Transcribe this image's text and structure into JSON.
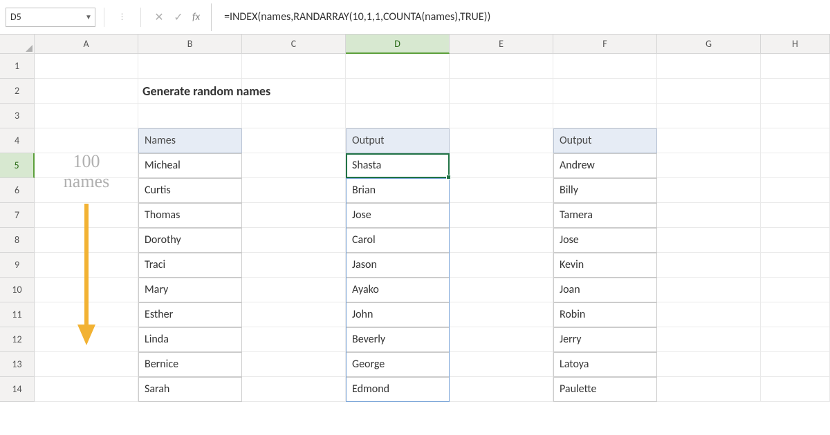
{
  "name_box": "D5",
  "formula": "=INDEX(names,RANDARRAY(10,1,1,COUNTA(names),TRUE))",
  "columns": [
    "A",
    "B",
    "C",
    "D",
    "E",
    "F",
    "G",
    "H"
  ],
  "rows": [
    "1",
    "2",
    "3",
    "4",
    "5",
    "6",
    "7",
    "8",
    "9",
    "10",
    "11",
    "12",
    "13",
    "14"
  ],
  "title": "Generate random names",
  "annotation": {
    "line1": "100",
    "line2": "names"
  },
  "tables": {
    "names": {
      "header": "Names",
      "rows": [
        "Micheal",
        "Curtis",
        "Thomas",
        "Dorothy",
        "Traci",
        "Mary",
        "Esther",
        "Linda",
        "Bernice",
        "Sarah"
      ]
    },
    "out1": {
      "header": "Output",
      "rows": [
        "Shasta",
        "Brian",
        "Jose",
        "Carol",
        "Jason",
        "Ayako",
        "John",
        "Beverly",
        "George",
        "Edmond"
      ]
    },
    "out2": {
      "header": "Output",
      "rows": [
        "Andrew",
        "Billy",
        "Tamera",
        "Jose",
        "Kevin",
        "Joan",
        "Robin",
        "Jerry",
        "Latoya",
        "Paulette"
      ]
    }
  },
  "active_col": "D",
  "active_row": "5"
}
